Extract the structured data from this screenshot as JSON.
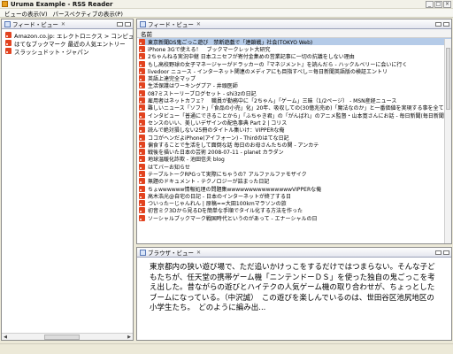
{
  "window": {
    "title": "Uruma Example - RSS Reader"
  },
  "menu": {
    "items": [
      "ビューの表示(V)",
      "パースペクティブの表示(P)"
    ]
  },
  "subscription_view": {
    "tab_label": "フィード・ビュー",
    "items": [
      "Amazon.co.jp: エレクトロニクス > コンピュータ&ベスト",
      "はてなブックマーク 最近の人気エントリー",
      "スラッシュドット・ジャパン"
    ]
  },
  "feed_view": {
    "tab_label": "フィード・ビュー",
    "column_header": "名前",
    "items": [
      "東京新聞DS鬼ごっこ遊び　禁断遊戯で「連鎖戦」社会(TOKYO Web)",
      "iPhone 3Gで使える！　ブックマークレット大研究",
      "2ちゃんねる実況中継 日本ユニセフが寄付金集めの営業記事に一切の抗議をしない理由",
      "もし高校野球の女子マネージャーがドラッカーの『マネジメント』を読んだら - ハックルベリーに会いに行く",
      "livedoor ニュース - インターネット関連のメディアにも目指すべし＝毎日新聞英語版の検証エントリ",
      "英語上達完全マップ",
      "生活保護はワーキングプア - 井頭医師",
      "087ミストーリーブログセット - shi3zの日記",
      "雇用者はネットカフェ？　職員が勤務中に「2ちゃん」「ゲーム」三昧（1/2ページ） - MSN産経ニュース",
      "難しいニュース「ソフト」「食品の小売」化」20年、吸収しての(30億兆売め)「魔法なのか」と一番価値を実現する事を全てのもの",
      "インタビュー「普通にできることから」「ふちゃき君」の「がんばれ」のアニメ監督・山本寛さんにお話 - 毎日新聞(毎日新聞)",
      "センスのいい、美しいデザインの配色事典 Part 2 | コリス",
      "読んで絶対損しない25冊のタイトル集いけ：VIPPERな俺",
      "ココがヘンだよiPhone(アイフォーン) - Thirdのはてな日記",
      "偏食することで生活をして面倒な話 毎日のお母さんたちの関 - アンカテ",
      "戦後を描いた日本の芸術 2008-07-11 - planet カラダン",
      "地球温暖化詐欺 - 池田信夫 blog",
      "はてバーお知らせ",
      "テーブルトークRPGって実際にちゃうの？アルファルファモザイク",
      "無題のドキュメント - テクノロジーが詰まった日記",
      "ちょwwwwww情報処理の問題集wwwwwwwwwwwwwwwVIPPERな俺",
      "高木浩光@自宅の日記 - 日本のインターネットが終了する日",
      "ついったーじゃんれん | 原稿==大田100kmマラソンの旅",
      "初音ミク3Dから見るDを簡単な手順でタイル化する方法を作った",
      "ソーシャルブックマーク戦国時代というのがあって - エナーシャルの日"
    ]
  },
  "browser_view": {
    "tab_label": "ブラウザ・ビュー",
    "text": "東京都内の狭い遊び場で、ただ追いかけっこをするだけではつまらない。そんな子どもたちが、任天堂の携帯ゲーム機「ニンテンドーＤＳ」を使った独自の鬼ごっこを考え出した。昔ながらの遊びとハイテクの人気ゲーム機の取り合わせが、ちょっとしたブームになっている。（中沢誠）　この遊びを楽しんでいるのは、世田谷区池尻地区の小学生たち。　どのように編み出..."
  },
  "colors": {
    "rss_orange": "#e2431f",
    "selection": "#b5cbe8"
  },
  "icons": [
    "app-icon",
    "view-icon",
    "rss-feed-icon"
  ]
}
